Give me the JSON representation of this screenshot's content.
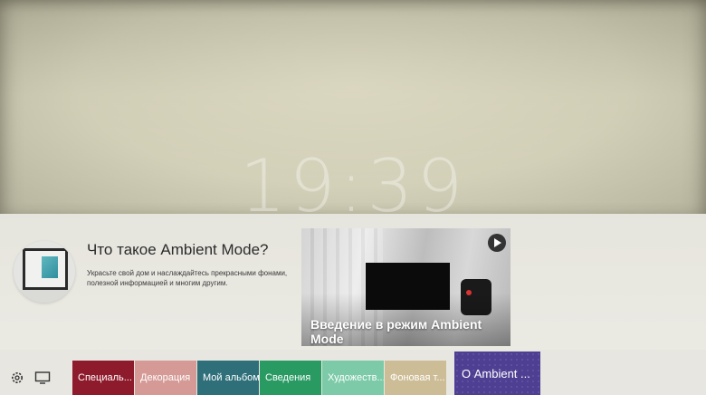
{
  "clock": {
    "time": "19:39"
  },
  "info": {
    "title": "Что такое Ambient Mode?",
    "description": "Украсьте свой дом и наслаждайтесь прекрасными фонами, полезной информацией и многим другим."
  },
  "video": {
    "caption": "Введение в режим Ambient Mode"
  },
  "bottom_bar": {
    "icons": [
      "settings-icon",
      "tv-icon"
    ],
    "tiles": [
      {
        "label": "Специаль...",
        "color": "#8e1b2c"
      },
      {
        "label": "Декорация",
        "color": "#d59a95"
      },
      {
        "label": "Мой альбом",
        "color": "#2e6f79"
      },
      {
        "label": "Сведения",
        "color": "#2a9a63"
      },
      {
        "label": "Художеств...",
        "color": "#7ccaa8"
      },
      {
        "label": "Фоновая т...",
        "color": "#cdbd96"
      }
    ],
    "selected_tile": {
      "label": "О Ambient ...",
      "color": "#4e3f93"
    }
  }
}
